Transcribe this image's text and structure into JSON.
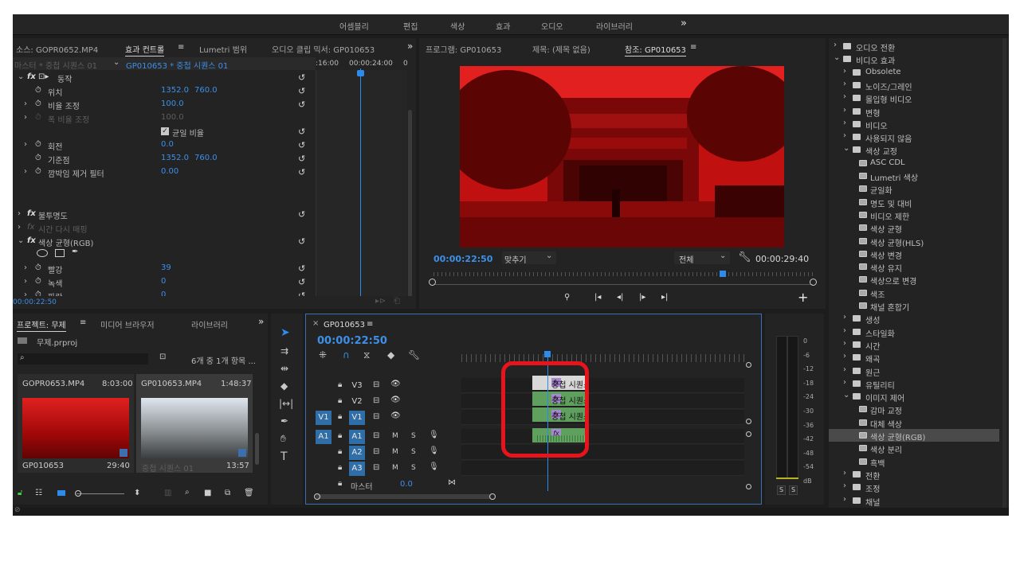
{
  "workspace_tabs": [
    "어셈블리",
    "편집",
    "색상",
    "효과",
    "오디오",
    "라이브러리"
  ],
  "more": "»",
  "effect_panel": {
    "tabs": [
      "소스: GOPR0652.MP4",
      "효과 컨트롤",
      "Lumetri 범위",
      "오디오 클립 믹서: GP010653"
    ],
    "menu": "≡",
    "seq_master": "마스터 * 중첩 시퀀스 01",
    "seq_current": "GP010653 * 중첩 시퀀스 01",
    "timecodes": [
      ":16:00",
      "00:00:24:00",
      "0"
    ],
    "motion_label": "동작",
    "rows": [
      {
        "label": "위치",
        "v1": "1352.0",
        "v2": "760.0"
      },
      {
        "label": "비율 조정",
        "v1": "100.0",
        "v2": ""
      },
      {
        "label": "폭 비율 조정",
        "v1": "100.0",
        "v2": ""
      },
      {
        "label": "균일 비율",
        "v1": "",
        "v2": ""
      },
      {
        "label": "회전",
        "v1": "0.0",
        "v2": ""
      },
      {
        "label": "기준점",
        "v1": "1352.0",
        "v2": "760.0"
      },
      {
        "label": "깜박임 제거 필터",
        "v1": "0.00",
        "v2": ""
      }
    ],
    "opacity": "불투명도",
    "time_remap": "시간 다시 매핑",
    "color_balance": "색상 균형(RGB)",
    "cb_rows": [
      {
        "label": "빨강",
        "v": "39"
      },
      {
        "label": "녹색",
        "v": "0"
      },
      {
        "label": "파랑",
        "v": "0"
      }
    ],
    "current_time": "00:00:22:50",
    "fx": "fx"
  },
  "program": {
    "tabs": [
      "프로그램: GP010653",
      "제목: (제목 없음)",
      "참조: GP010653"
    ],
    "timecode": "00:00:22:50",
    "fit": "맞추기",
    "full": "전체",
    "duration": "00:00:29:40"
  },
  "project": {
    "tabs": [
      "프로젝트: 무제",
      "미디어 브라우저",
      "라이브러리"
    ],
    "file": "무제.prproj",
    "count": "6개 중 1개 항목 ...",
    "items": [
      {
        "name": "GOPR0653.MP4",
        "time": "8:03:00",
        "bottom": "GP010653",
        "bottom_time": "29:40"
      },
      {
        "name": "GP010653.MP4",
        "time": "1:48:37",
        "bottom": "중첩 시퀀스 01",
        "bottom_time": "13:57"
      }
    ]
  },
  "timeline": {
    "tab": "GP010653",
    "timecode": "00:00:22:50",
    "tracks": [
      {
        "src": "",
        "name": "V3",
        "type": "v"
      },
      {
        "src": "",
        "name": "V2",
        "type": "v"
      },
      {
        "src": "V1",
        "name": "V1",
        "type": "v"
      },
      {
        "src": "A1",
        "name": "A1",
        "type": "a"
      },
      {
        "src": "",
        "name": "A2",
        "type": "a"
      },
      {
        "src": "",
        "name": "A3",
        "type": "a"
      }
    ],
    "master_label": "마스터",
    "master_val": "0.0",
    "clip_label": "중첩 시퀀스 01",
    "m": "M",
    "s": "S"
  },
  "meter": {
    "labels": [
      "0",
      "-6",
      "-12",
      "-18",
      "-24",
      "-30",
      "-36",
      "-42",
      "-48",
      "-54",
      "dB"
    ],
    "s": "S"
  },
  "effects_tree": [
    {
      "depth": 0,
      "open": false,
      "label": "오디오 전환",
      "type": "folder"
    },
    {
      "depth": 0,
      "open": true,
      "label": "비디오 효과",
      "type": "folder"
    },
    {
      "depth": 1,
      "open": false,
      "label": "Obsolete",
      "type": "folder"
    },
    {
      "depth": 1,
      "open": false,
      "label": "노이즈/그레인",
      "type": "folder"
    },
    {
      "depth": 1,
      "open": false,
      "label": "몰입형 비디오",
      "type": "folder"
    },
    {
      "depth": 1,
      "open": false,
      "label": "변형",
      "type": "folder"
    },
    {
      "depth": 1,
      "open": false,
      "label": "비디오",
      "type": "folder"
    },
    {
      "depth": 1,
      "open": false,
      "label": "사용되지 않음",
      "type": "folder"
    },
    {
      "depth": 1,
      "open": true,
      "label": "색상 교정",
      "type": "folder"
    },
    {
      "depth": 2,
      "label": "ASC CDL",
      "type": "fx"
    },
    {
      "depth": 2,
      "label": "Lumetri 색상",
      "type": "fx"
    },
    {
      "depth": 2,
      "label": "균일화",
      "type": "fx"
    },
    {
      "depth": 2,
      "label": "명도 및 대비",
      "type": "fx"
    },
    {
      "depth": 2,
      "label": "비디오 제한",
      "type": "fx"
    },
    {
      "depth": 2,
      "label": "색상 균형",
      "type": "fx"
    },
    {
      "depth": 2,
      "label": "색상 균형(HLS)",
      "type": "fx"
    },
    {
      "depth": 2,
      "label": "색상 변경",
      "type": "fx"
    },
    {
      "depth": 2,
      "label": "색상 유지",
      "type": "fx"
    },
    {
      "depth": 2,
      "label": "색상으로 변경",
      "type": "fx"
    },
    {
      "depth": 2,
      "label": "색조",
      "type": "fx"
    },
    {
      "depth": 2,
      "label": "채널 혼합기",
      "type": "fx"
    },
    {
      "depth": 1,
      "open": false,
      "label": "생성",
      "type": "folder"
    },
    {
      "depth": 1,
      "open": false,
      "label": "스타일화",
      "type": "folder"
    },
    {
      "depth": 1,
      "open": false,
      "label": "시간",
      "type": "folder"
    },
    {
      "depth": 1,
      "open": false,
      "label": "왜곡",
      "type": "folder"
    },
    {
      "depth": 1,
      "open": false,
      "label": "원근",
      "type": "folder"
    },
    {
      "depth": 1,
      "open": false,
      "label": "유틸리티",
      "type": "folder"
    },
    {
      "depth": 1,
      "open": true,
      "label": "이미지 제어",
      "type": "folder"
    },
    {
      "depth": 2,
      "label": "감마 교정",
      "type": "fx"
    },
    {
      "depth": 2,
      "label": "대체 색상",
      "type": "fx"
    },
    {
      "depth": 2,
      "label": "색상 균형(RGB)",
      "type": "fx",
      "selected": true
    },
    {
      "depth": 2,
      "label": "색상 분리",
      "type": "fx"
    },
    {
      "depth": 2,
      "label": "흑백",
      "type": "fx"
    },
    {
      "depth": 1,
      "open": false,
      "label": "전환",
      "type": "folder"
    },
    {
      "depth": 1,
      "open": false,
      "label": "조정",
      "type": "folder"
    },
    {
      "depth": 1,
      "open": false,
      "label": "채널",
      "type": "folder"
    }
  ],
  "colors": {
    "accent": "#2d8ceb",
    "highlight": "#e8131b",
    "clip": "#5fa05f"
  }
}
